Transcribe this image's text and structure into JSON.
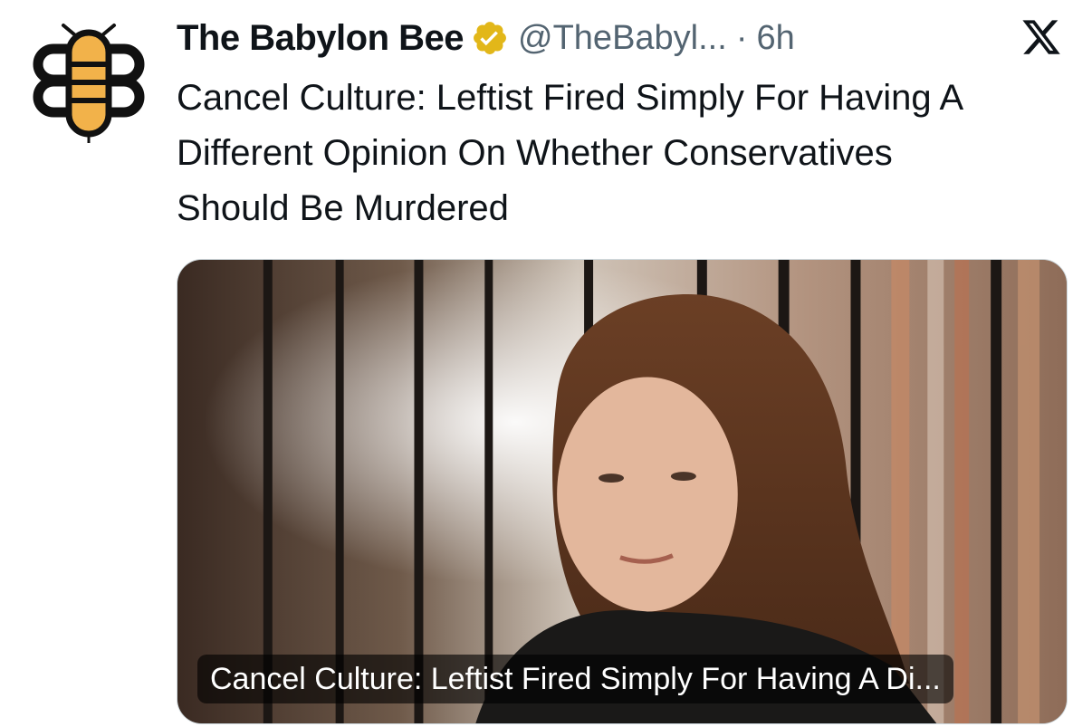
{
  "tweet": {
    "display_name": "The Babylon Bee",
    "handle": "@TheBabyl...",
    "separator": "·",
    "time": "6h",
    "text": "Cancel Culture: Leftist Fired Simply For Having A Different Opinion On Whether Conservatives Should Be Murdered",
    "avatar_icon": "babylon-bee-logo",
    "verified_icon": "gold-verified-badge",
    "platform_icon": "x-logo"
  },
  "card": {
    "caption": "Cancel Culture: Leftist Fired Simply For Having A Di...",
    "image_description_icon": "article-photo"
  },
  "colors": {
    "text": "#0f1419",
    "secondary": "#536471",
    "verified_gold": "#e2b719",
    "bee_yellow": "#f2b24a",
    "bee_outline": "#111111"
  }
}
